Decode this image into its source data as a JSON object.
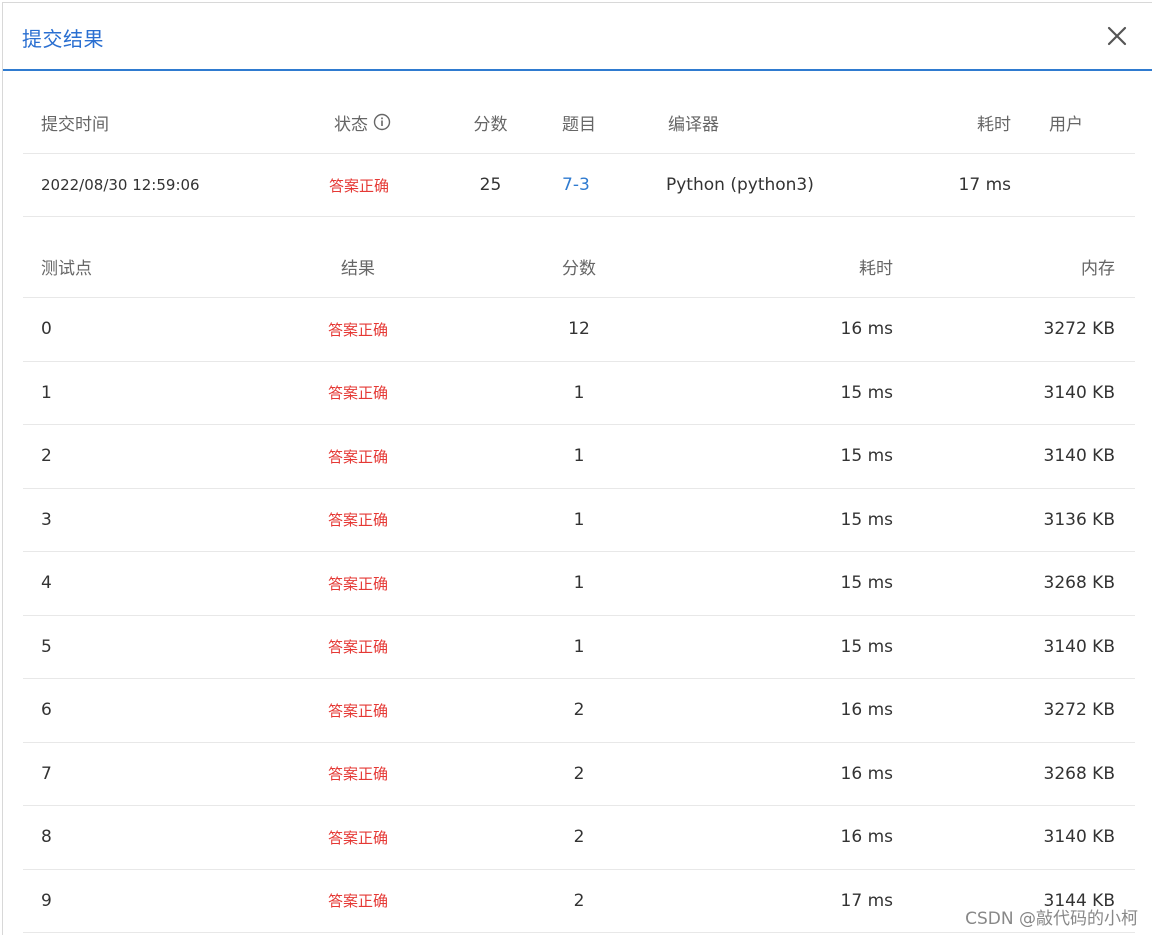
{
  "modal": {
    "title": "提交结果",
    "close_icon": "close-icon"
  },
  "summary": {
    "headers": {
      "time": "提交时间",
      "status": "状态",
      "score": "分数",
      "problem": "题目",
      "compiler": "编译器",
      "elapsed": "耗时",
      "user": "用户"
    },
    "row": {
      "time": "2022/08/30 12:59:06",
      "status": "答案正确",
      "score": "25",
      "problem": "7-3",
      "compiler": "Python (python3)",
      "elapsed": "17 ms",
      "user": ""
    }
  },
  "tests": {
    "headers": {
      "case": "测试点",
      "result": "结果",
      "score": "分数",
      "elapsed": "耗时",
      "memory": "内存"
    },
    "rows": [
      {
        "case": "0",
        "result": "答案正确",
        "score": "12",
        "elapsed": "16 ms",
        "memory": "3272 KB"
      },
      {
        "case": "1",
        "result": "答案正确",
        "score": "1",
        "elapsed": "15 ms",
        "memory": "3140 KB"
      },
      {
        "case": "2",
        "result": "答案正确",
        "score": "1",
        "elapsed": "15 ms",
        "memory": "3140 KB"
      },
      {
        "case": "3",
        "result": "答案正确",
        "score": "1",
        "elapsed": "15 ms",
        "memory": "3136 KB"
      },
      {
        "case": "4",
        "result": "答案正确",
        "score": "1",
        "elapsed": "15 ms",
        "memory": "3268 KB"
      },
      {
        "case": "5",
        "result": "答案正确",
        "score": "1",
        "elapsed": "15 ms",
        "memory": "3140 KB"
      },
      {
        "case": "6",
        "result": "答案正确",
        "score": "2",
        "elapsed": "16 ms",
        "memory": "3272 KB"
      },
      {
        "case": "7",
        "result": "答案正确",
        "score": "2",
        "elapsed": "16 ms",
        "memory": "3268 KB"
      },
      {
        "case": "8",
        "result": "答案正确",
        "score": "2",
        "elapsed": "16 ms",
        "memory": "3140 KB"
      },
      {
        "case": "9",
        "result": "答案正确",
        "score": "2",
        "elapsed": "17 ms",
        "memory": "3144 KB"
      }
    ]
  },
  "watermark": "CSDN @敲代码的小柯",
  "colors": {
    "accent": "#2f7bd0",
    "status_ok": "#e53935"
  }
}
